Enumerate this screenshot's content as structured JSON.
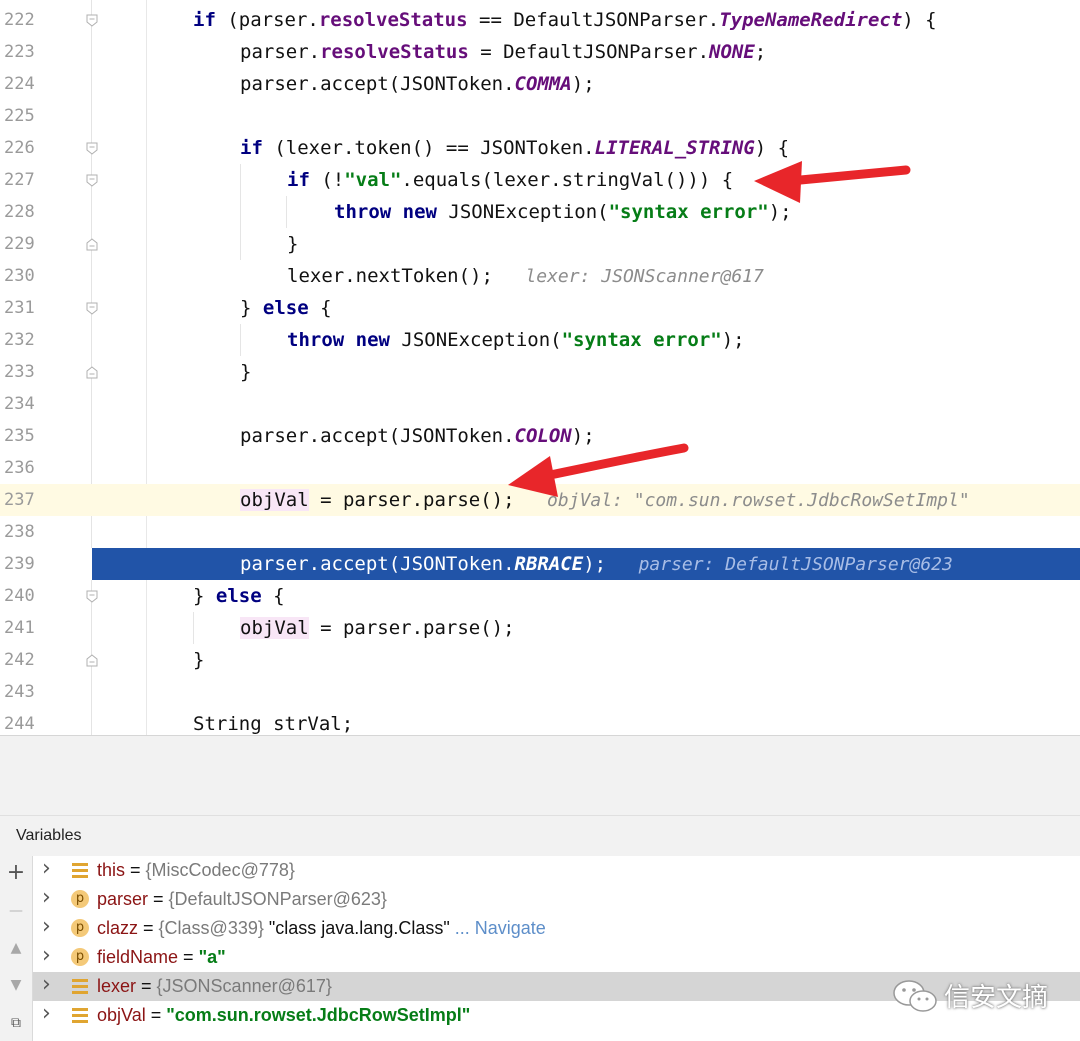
{
  "editor": {
    "lines": [
      {
        "num": "222",
        "indent": 1,
        "fold": "open",
        "segs": [
          {
            "t": "if",
            "c": "kw"
          },
          {
            "t": " (parser."
          },
          {
            "t": "resolveStatus",
            "c": "fld"
          },
          {
            "t": " == DefaultJSONParser."
          },
          {
            "t": "TypeNameRedirect",
            "c": "cst"
          },
          {
            "t": ") {"
          }
        ]
      },
      {
        "num": "223",
        "indent": 2,
        "segs": [
          {
            "t": "parser."
          },
          {
            "t": "resolveStatus",
            "c": "fld"
          },
          {
            "t": " = DefaultJSONParser."
          },
          {
            "t": "NONE",
            "c": "cst"
          },
          {
            "t": ";"
          }
        ]
      },
      {
        "num": "224",
        "indent": 2,
        "segs": [
          {
            "t": "parser.accept(JSONToken."
          },
          {
            "t": "COMMA",
            "c": "cst"
          },
          {
            "t": ");"
          }
        ]
      },
      {
        "num": "225",
        "indent": 2,
        "segs": []
      },
      {
        "num": "226",
        "indent": 2,
        "fold": "open",
        "segs": [
          {
            "t": "if",
            "c": "kw"
          },
          {
            "t": " (lexer.token() == JSONToken."
          },
          {
            "t": "LITERAL_STRING",
            "c": "cst"
          },
          {
            "t": ") {"
          }
        ]
      },
      {
        "num": "227",
        "indent": 3,
        "fold": "open",
        "segs": [
          {
            "t": "if",
            "c": "kw"
          },
          {
            "t": " (!"
          },
          {
            "t": "\"val\"",
            "c": "str"
          },
          {
            "t": ".equals(lexer.stringVal())) {"
          }
        ]
      },
      {
        "num": "228",
        "indent": 4,
        "segs": [
          {
            "t": "throw",
            "c": "kw"
          },
          {
            "t": " "
          },
          {
            "t": "new",
            "c": "kw"
          },
          {
            "t": " JSONException("
          },
          {
            "t": "\"syntax error\"",
            "c": "str"
          },
          {
            "t": ");"
          }
        ]
      },
      {
        "num": "229",
        "indent": 3,
        "fold": "close",
        "segs": [
          {
            "t": "}"
          }
        ]
      },
      {
        "num": "230",
        "indent": 3,
        "segs": [
          {
            "t": "lexer.nextToken();"
          },
          {
            "t": "   lexer: JSONScanner@617",
            "c": "hint"
          }
        ]
      },
      {
        "num": "231",
        "indent": 2,
        "fold": "open",
        "segs": [
          {
            "t": "} "
          },
          {
            "t": "else",
            "c": "kw"
          },
          {
            "t": " {"
          }
        ]
      },
      {
        "num": "232",
        "indent": 3,
        "segs": [
          {
            "t": "throw",
            "c": "kw"
          },
          {
            "t": " "
          },
          {
            "t": "new",
            "c": "kw"
          },
          {
            "t": " JSONException("
          },
          {
            "t": "\"syntax error\"",
            "c": "str"
          },
          {
            "t": ");"
          }
        ]
      },
      {
        "num": "233",
        "indent": 2,
        "fold": "close",
        "segs": [
          {
            "t": "}"
          }
        ]
      },
      {
        "num": "234",
        "indent": 2,
        "segs": []
      },
      {
        "num": "235",
        "indent": 2,
        "segs": [
          {
            "t": "parser.accept(JSONToken."
          },
          {
            "t": "COLON",
            "c": "cst"
          },
          {
            "t": ");"
          }
        ]
      },
      {
        "num": "236",
        "indent": 2,
        "segs": []
      },
      {
        "num": "237",
        "indent": 2,
        "state": "hl",
        "segs": [
          {
            "t": "objVal",
            "c": "lv"
          },
          {
            "t": " = parser.parse();"
          },
          {
            "t": "   objVal: \"com.sun.rowset.JdbcRowSetImpl\"",
            "c": "hint"
          }
        ]
      },
      {
        "num": "238",
        "indent": 2,
        "segs": []
      },
      {
        "num": "239",
        "indent": 2,
        "state": "exec",
        "segs": [
          {
            "t": "parser.accept(JSONToken."
          },
          {
            "t": "RBRACE",
            "c": "cst"
          },
          {
            "t": ");"
          },
          {
            "t": "   parser: DefaultJSONParser@623",
            "c": "hint"
          }
        ]
      },
      {
        "num": "240",
        "indent": 1,
        "fold": "open",
        "segs": [
          {
            "t": "} "
          },
          {
            "t": "else",
            "c": "kw"
          },
          {
            "t": " {"
          }
        ]
      },
      {
        "num": "241",
        "indent": 2,
        "segs": [
          {
            "t": "objVal",
            "c": "lv"
          },
          {
            "t": " = parser.parse();"
          }
        ]
      },
      {
        "num": "242",
        "indent": 1,
        "fold": "close",
        "segs": [
          {
            "t": "}"
          }
        ]
      },
      {
        "num": "243",
        "indent": 1,
        "segs": []
      },
      {
        "num": "244",
        "indent": 1,
        "segs": [
          {
            "t": "String strVal;"
          }
        ]
      }
    ]
  },
  "debugger": {
    "panel_title": "Variables",
    "tools": [
      {
        "name": "add-watch-icon",
        "glyph": "+"
      },
      {
        "name": "remove-watch-icon",
        "glyph": "—"
      },
      {
        "name": "move-up-icon",
        "glyph": "▲"
      },
      {
        "name": "move-down-icon",
        "glyph": "▼"
      },
      {
        "name": "copy-icon",
        "glyph": "⧉"
      }
    ],
    "variables": [
      {
        "icon": "field",
        "name": "this",
        "eq": " = ",
        "ref": "{MiscCodec@778}",
        "extra": "",
        "link": ""
      },
      {
        "icon": "param",
        "name": "parser",
        "eq": " = ",
        "ref": "{DefaultJSONParser@623}",
        "extra": "",
        "link": ""
      },
      {
        "icon": "param",
        "name": "clazz",
        "eq": " = ",
        "ref": "{Class@339} ",
        "extra": "\"class java.lang.Class\"",
        "link": " ... Navigate"
      },
      {
        "icon": "param",
        "name": "fieldName",
        "eq": " = ",
        "ref": "",
        "extra": "",
        "green": "\"a\"",
        "link": ""
      },
      {
        "icon": "field",
        "name": "lexer",
        "eq": " = ",
        "ref": "{JSONScanner@617}",
        "extra": "",
        "link": "",
        "selected": true
      },
      {
        "icon": "field",
        "name": "objVal",
        "eq": " = ",
        "ref": "",
        "extra": "",
        "green": "\"com.sun.rowset.JdbcRowSetImpl\"",
        "link": ""
      }
    ]
  },
  "watermark": {
    "text": "信安文摘"
  },
  "colors": {
    "exec_line": "#2154a8",
    "highlight_line": "#fffae3",
    "arrow": "#e8262a",
    "keyword": "#000080",
    "constant": "#660e7a",
    "string": "#067d17"
  }
}
